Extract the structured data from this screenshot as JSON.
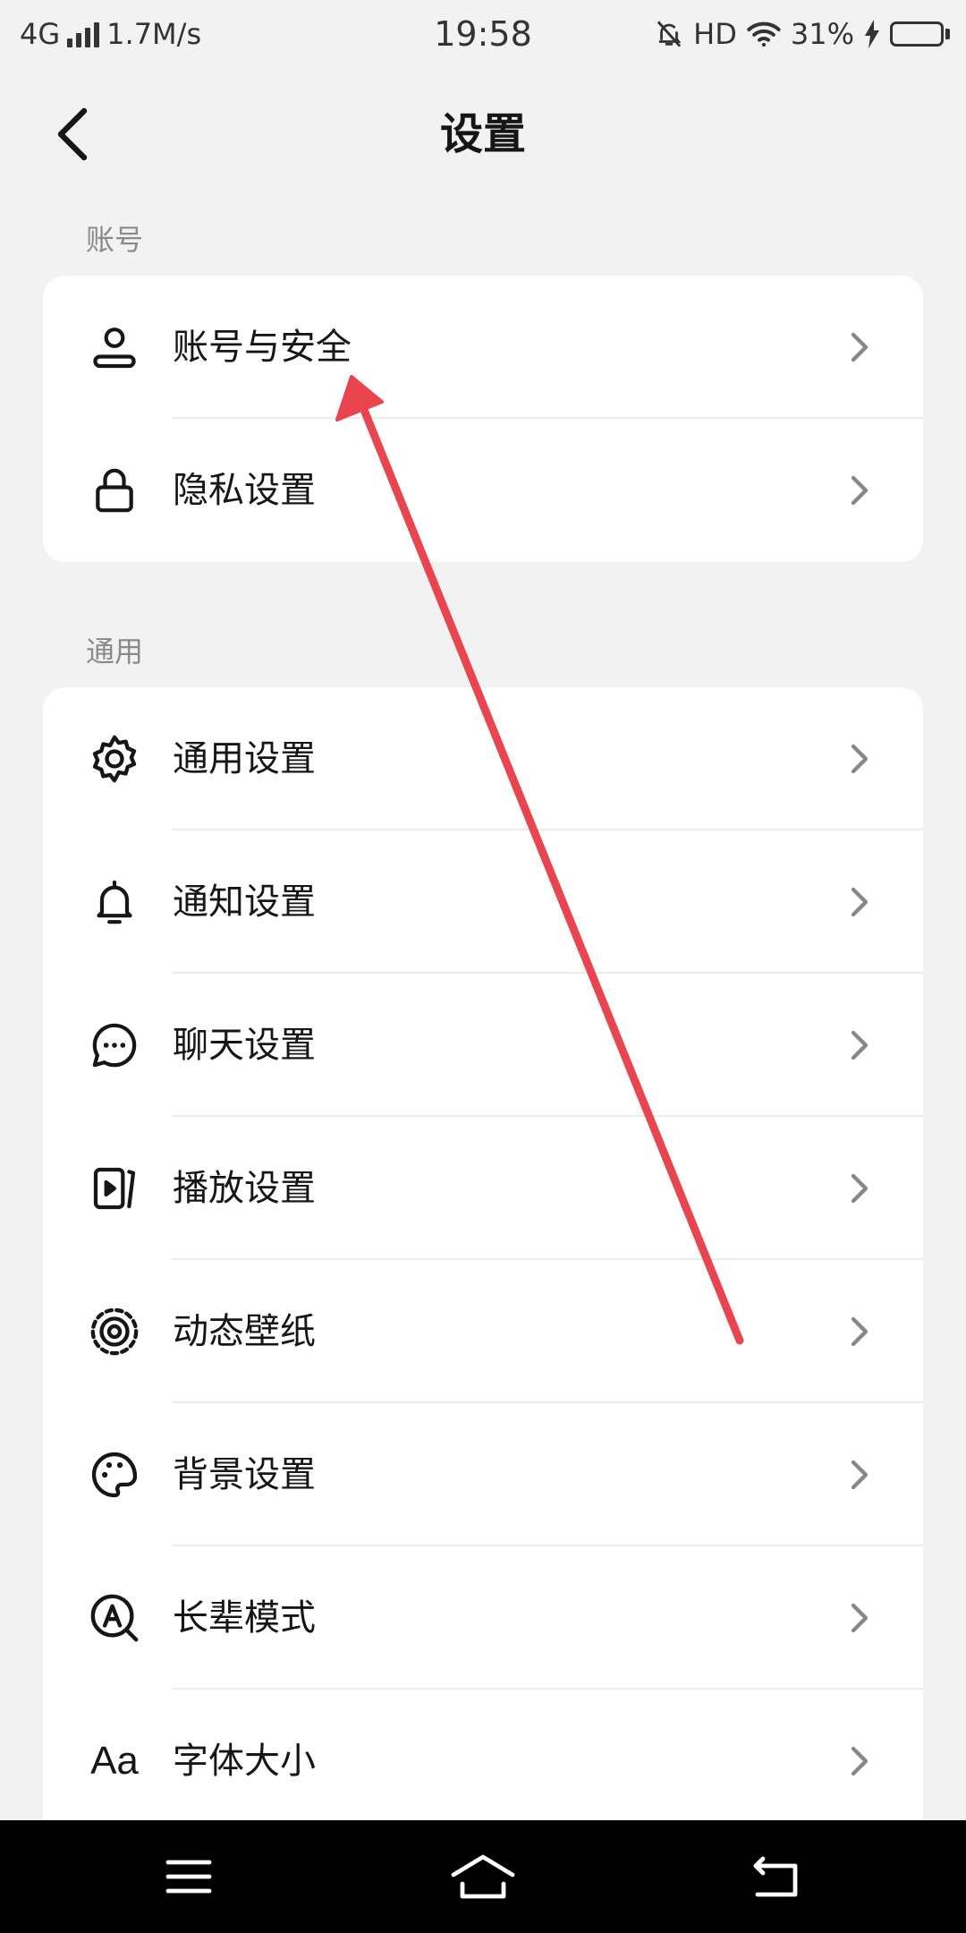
{
  "status_bar": {
    "network": "4G",
    "speed": "1.7M/s",
    "time": "19:58",
    "hd": "HD",
    "battery_percent": "31%",
    "battery_level": 0.31
  },
  "header": {
    "title": "设置"
  },
  "sections": {
    "account": {
      "label": "账号",
      "items": [
        {
          "label": "账号与安全",
          "icon": "user-icon"
        },
        {
          "label": "隐私设置",
          "icon": "lock-icon"
        }
      ]
    },
    "general": {
      "label": "通用",
      "items": [
        {
          "label": "通用设置",
          "icon": "gear-icon"
        },
        {
          "label": "通知设置",
          "icon": "bell-icon"
        },
        {
          "label": "聊天设置",
          "icon": "chat-bubble-icon"
        },
        {
          "label": "播放设置",
          "icon": "play-icon"
        },
        {
          "label": "动态壁纸",
          "icon": "wallpaper-icon"
        },
        {
          "label": "背景设置",
          "icon": "palette-icon"
        },
        {
          "label": "长辈模式",
          "icon": "elder-mode-icon"
        },
        {
          "label": "字体大小",
          "icon": "font-size-icon",
          "glyph": "Aa"
        }
      ]
    }
  },
  "colors": {
    "background": "#f2f2f2",
    "card": "#ffffff",
    "annotation_arrow": "#e8454f",
    "nav_bar": "#000000"
  }
}
